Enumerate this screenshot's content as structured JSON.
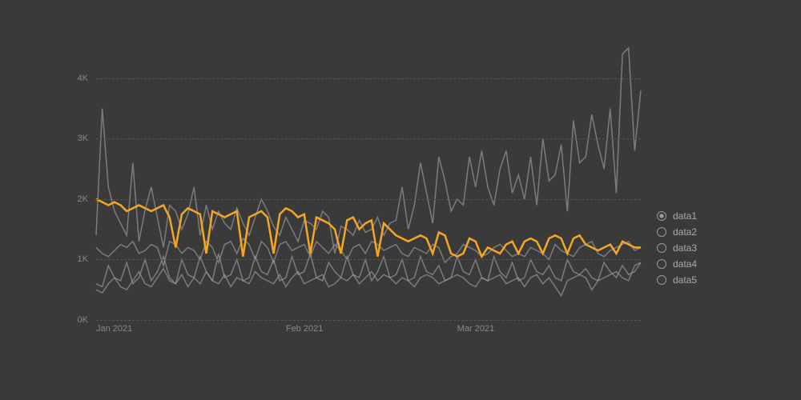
{
  "chart_data": {
    "type": "line",
    "xlabel": "",
    "ylabel": "",
    "ylim": [
      0,
      4500
    ],
    "y_ticks": [
      0,
      1000,
      2000,
      3000,
      4000
    ],
    "y_tick_labels": [
      "0K",
      "1K",
      "2K",
      "3K",
      "4K"
    ],
    "x_tick_indices": [
      0,
      31,
      59
    ],
    "x_tick_labels": [
      "Jan 2021",
      "Feb 2021",
      "Mar 2021"
    ],
    "x_count": 90,
    "series": [
      {
        "name": "data1",
        "color": "#f5a623",
        "highlighted": true,
        "values": [
          2000,
          1950,
          1900,
          1950,
          1900,
          1800,
          1850,
          1900,
          1850,
          1800,
          1850,
          1900,
          1700,
          1200,
          1750,
          1850,
          1800,
          1750,
          1100,
          1800,
          1750,
          1700,
          1750,
          1800,
          1050,
          1700,
          1750,
          1800,
          1700,
          1100,
          1750,
          1850,
          1800,
          1700,
          1750,
          1100,
          1700,
          1650,
          1600,
          1500,
          1100,
          1650,
          1700,
          1500,
          1600,
          1650,
          1050,
          1600,
          1500,
          1400,
          1350,
          1300,
          1350,
          1400,
          1350,
          1100,
          1450,
          1400,
          1100,
          1050,
          1100,
          1350,
          1300,
          1050,
          1200,
          1150,
          1100,
          1250,
          1300,
          1100,
          1300,
          1350,
          1300,
          1100,
          1350,
          1400,
          1350,
          1100,
          1350,
          1400,
          1250,
          1200,
          1150,
          1200,
          1250,
          1100,
          1300,
          1250,
          1200,
          1200
        ]
      },
      {
        "name": "data2",
        "color": "#999",
        "values": [
          1400,
          3500,
          2200,
          1800,
          1600,
          1400,
          2600,
          1300,
          1820,
          2200,
          1700,
          1200,
          1900,
          1800,
          1500,
          1750,
          2200,
          1400,
          1900,
          1500,
          1800,
          1600,
          1500,
          1850,
          1600,
          1400,
          1700,
          2000,
          1800,
          1550,
          1400,
          1700,
          1500,
          1300,
          1650,
          1600,
          1500,
          1800,
          1700,
          1100,
          1550,
          1500,
          1400,
          1650,
          1450,
          1500,
          1700,
          1400,
          1600,
          1650,
          2200,
          1500,
          1900,
          2600,
          2100,
          1600,
          2700,
          2300,
          1800,
          2000,
          1900,
          2700,
          2200,
          2800,
          2200,
          1900,
          2500,
          2800,
          2100,
          2400,
          2000,
          2700,
          1900,
          3000,
          2300,
          2400,
          2900,
          1800,
          3300,
          2600,
          2700,
          3400,
          2900,
          2500,
          3500,
          2100,
          4400,
          4500,
          2800,
          3800
        ]
      },
      {
        "name": "data3",
        "color": "#999",
        "values": [
          1200,
          1100,
          1050,
          1150,
          1250,
          1200,
          1300,
          1100,
          1150,
          1250,
          1200,
          900,
          1300,
          1250,
          1100,
          1200,
          1150,
          1000,
          1300,
          1200,
          950,
          1250,
          1300,
          1100,
          1350,
          1250,
          1000,
          1300,
          1200,
          950,
          1250,
          1300,
          1150,
          1200,
          1250,
          1050,
          1300,
          1200,
          1100,
          1250,
          1150,
          1000,
          1200,
          1250,
          1100,
          1300,
          1250,
          1150,
          1200,
          1250,
          1100,
          1050,
          1200,
          1150,
          1100,
          1250,
          1200,
          950,
          1050,
          1100,
          1250,
          1200,
          1150,
          1050,
          1100,
          1200,
          1250,
          1150,
          1050,
          1100,
          1050,
          1200,
          1150,
          1100,
          1000,
          1250,
          1150,
          1100,
          1050,
          1200,
          1250,
          1300,
          1100,
          1050,
          1150,
          1200,
          1250,
          1300,
          1150,
          1200
        ]
      },
      {
        "name": "data4",
        "color": "#999",
        "values": [
          600,
          550,
          900,
          700,
          650,
          950,
          600,
          700,
          1000,
          650,
          800,
          1050,
          700,
          600,
          1000,
          750,
          700,
          1050,
          800,
          650,
          1100,
          700,
          750,
          1000,
          650,
          700,
          1050,
          800,
          750,
          1000,
          650,
          700,
          1050,
          750,
          800,
          1100,
          700,
          650,
          950,
          800,
          700,
          1050,
          750,
          700,
          1000,
          650,
          800,
          1050,
          700,
          750,
          1000,
          650,
          700,
          1050,
          800,
          750,
          900,
          650,
          700,
          1050,
          800,
          750,
          1000,
          700,
          650,
          1050,
          800,
          700,
          950,
          650,
          700,
          1000,
          800,
          750,
          900,
          700,
          650,
          1000,
          800,
          750,
          850,
          700,
          650,
          950,
          800,
          700,
          900,
          750,
          800,
          950
        ]
      },
      {
        "name": "data5",
        "color": "#999",
        "values": [
          500,
          450,
          600,
          700,
          550,
          500,
          650,
          800,
          600,
          550,
          700,
          850,
          650,
          600,
          750,
          550,
          700,
          600,
          800,
          650,
          600,
          750,
          550,
          700,
          650,
          600,
          800,
          700,
          650,
          600,
          750,
          550,
          700,
          800,
          600,
          650,
          700,
          750,
          550,
          600,
          700,
          650,
          750,
          600,
          700,
          800,
          650,
          750,
          700,
          600,
          700,
          650,
          550,
          700,
          750,
          700,
          600,
          650,
          700,
          750,
          700,
          600,
          550,
          700,
          650,
          700,
          750,
          600,
          650,
          700,
          550,
          700,
          750,
          600,
          700,
          550,
          400,
          650,
          700,
          750,
          700,
          500,
          650,
          700,
          750,
          800,
          700,
          650,
          900,
          950
        ]
      }
    ]
  },
  "legend": {
    "items": [
      {
        "label": "data1",
        "selected": true
      },
      {
        "label": "data2",
        "selected": false
      },
      {
        "label": "data3",
        "selected": false
      },
      {
        "label": "data4",
        "selected": false
      },
      {
        "label": "data5",
        "selected": false
      }
    ]
  }
}
